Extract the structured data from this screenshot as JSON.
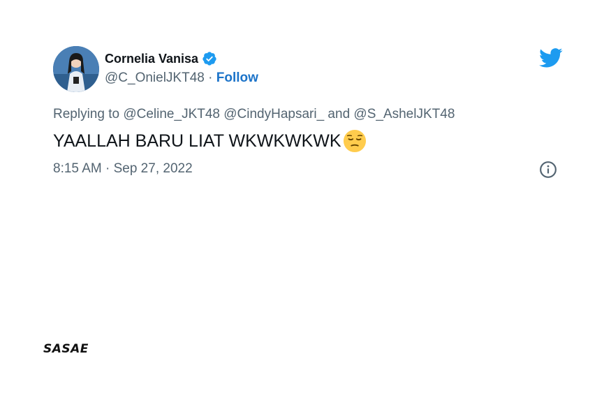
{
  "user": {
    "display_name": "Cornelia Vanisa",
    "handle": "@C_OnielJKT48",
    "separator": "·",
    "follow_label": "Follow"
  },
  "tweet": {
    "reply_prefix": "Replying to",
    "reply_to": "@Celine_JKT48 @CindyHapsari_ and @S_AshelJKT48",
    "text": "YAALLAH BARU LIAT WKWKWKWK",
    "emoji": "pensive-face",
    "timestamp": "8:15 AM · Sep 27, 2022"
  },
  "watermark": {
    "label": "SASAE"
  },
  "colors": {
    "twitter_blue": "#1d9bf0",
    "follow_blue": "#1d74c9",
    "secondary_text": "#536471",
    "primary_text": "#0f1419"
  },
  "icons": {
    "verified": "verified-badge-icon",
    "bird": "twitter-bird-icon",
    "info": "info-icon"
  }
}
